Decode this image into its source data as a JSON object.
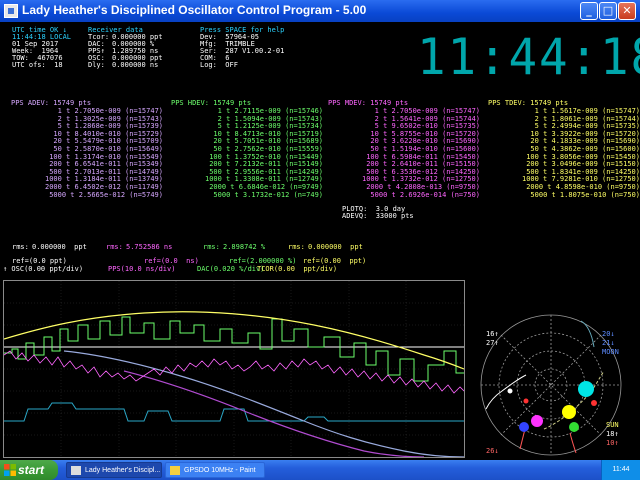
{
  "window": {
    "title": "Lady Heather's Disciplined Oscillator Control Program - 5.00",
    "buttons": {
      "minimize": "_",
      "maximize": "□",
      "close": "✕"
    }
  },
  "status": {
    "col1": [
      "UTC time OK ↓",
      "11:44:18 LOCAL",
      "01 Sep 2017",
      "Week:  1964",
      "TOW:  467076",
      "UTC ofs:  18"
    ],
    "col2": [
      "Receiver data",
      "Tcor:",
      "DAC:",
      "PPS↑",
      "OSC:",
      "Dly:"
    ],
    "col2_values": [
      "",
      "0.000000 ppt",
      "0.000000 %",
      "1.289750 ns",
      "0.000000 ppt",
      "0.000000 ns"
    ],
    "col3": [
      "Press SPACE for help",
      "Dev:  57964-05",
      "Mfg:  TRIMBLE",
      "Ser:  287 V1.00.2-01",
      "COM:  6",
      "Log:  OFF"
    ]
  },
  "clock": "11:44:18",
  "adev": {
    "tables": [
      {
        "header": "PPS ADEV: 15749 pts",
        "color": "#d6a7ff",
        "rows": [
          "1 t 2.7050e-009 (n=15747)",
          "2 t 1.3025e-009 (n=15743)",
          "5 t 1.2868e-009 (n=15739)",
          "10 t 8.4010e-010 (n=15729)",
          "20 t 5.5479e-010 (n=15709)",
          "50 t 2.5870e-010 (n=15649)",
          "100 t 1.3174e-010 (n=15549)",
          "200 t 6.6541e-011 (n=15349)",
          "500 t 2.7013e-011 (n=14749)",
          "1000 t 1.3184e-011 (n=13749)",
          "2000 t 6.4502e-012 (n=11749)",
          "5000 t 2.5665e-012 (n=5749)"
        ]
      },
      {
        "header": "PPS HDEV: 15749 pts",
        "color": "#6cff6c",
        "rows": [
          "1 t 2.7115e-009 (n=15746)",
          "2 t 1.5094e-009 (n=15743)",
          "5 t 1.2125e-009 (n=15734)",
          "10 t 8.4713e-010 (n=15719)",
          "20 t 5.7051e-010 (n=15689)",
          "50 t 2.7562e-010 (n=15559)",
          "100 t 1.3752e-010 (n=15449)",
          "200 t 7.2132e-011 (n=15149)",
          "500 t 2.9556e-011 (n=14249)",
          "1000 t 1.3308e-011 (n=12749)",
          "2000 t 6.6846e-012 (n=9749)",
          "5000 t 3.1732e-012 (n=749)"
        ]
      },
      {
        "header": "PPS MDEV: 15749 pts",
        "color": "#ff66ff",
        "rows": [
          "1 t 2.7050e-009 (n=15747)",
          "2 t 1.5641e-009 (n=15744)",
          "5 t 9.6502e-010 (n=15735)",
          "10 t 5.8755e-010 (n=15720)",
          "20 t 3.6228e-010 (n=15690)",
          "50 t 1.5194e-010 (n=15600)",
          "100 t 6.5984e-011 (n=15450)",
          "200 t 2.6410e-011 (n=15150)",
          "500 t 6.3536e-012 (n=14250)",
          "1000 t 1.3732e-012 (n=12750)",
          "2000 t 4.2808e-013 (n=9750)",
          "5000 t 2.6926e-014 (n=750)"
        ]
      },
      {
        "header": "PPS TDEV: 15749 pts",
        "color": "#ffff66",
        "rows": [
          "1 t 1.5617e-009 (n=15747)",
          "2 t 1.8061e-009 (n=15744)",
          "5 t 2.4994e-009 (n=15735)",
          "10 t 3.3922e-009 (n=15720)",
          "20 t 4.1833e-009 (n=15690)",
          "50 t 4.3862e-009 (n=15600)",
          "100 t 3.8056e-009 (n=15450)",
          "200 t 3.0496e-009 (n=15150)",
          "500 t 1.8341e-009 (n=14250)",
          "1000 t 7.9281e-010 (n=12750)",
          "2000 t 4.8598e-010 (n=9750)",
          "5000 t 1.8075e-010 (n=750)"
        ]
      }
    ]
  },
  "plotq": {
    "line1": "PLOTQ:  3.0 day",
    "line2": "ADEVQ:  33000 pts"
  },
  "rms": {
    "rms1_label": "rms:",
    "rms1_value": "0.000000  ppt",
    "rms2_label": "rms:",
    "rms2_value": "5.752586 ns",
    "rms3_label": "rms:",
    "rms3_value": "2.898742 %",
    "rms4_label": "rms:",
    "rms4_value": "0.000000  ppt"
  },
  "refs": {
    "osc_ref": "ref=(0.0 ppt)",
    "pps_ref": "ref=(0.0  ns)",
    "dac_ref": "ref=(2.000000 %)",
    "tcor_ref": "ref=(0.00  ppt)",
    "osc_scale": "↑ OSC(0.00 ppt/div)",
    "pps_scale": "PPS(10.0 ns/div)",
    "dac_scale": "DAC(0.020 %/div)",
    "tcor_scale": "TCOR(0.00  ppt/div)"
  },
  "satmap": {
    "labels": [
      "16↑",
      "27↑",
      "20↓",
      "21↓",
      "MOON",
      "SUN",
      "18↑",
      "10↑",
      "26↓"
    ]
  },
  "colors": {
    "status_cyan": "#2bd3ff",
    "status_blue": "#5ea8ff",
    "adev": "#d6a7ff",
    "hdev": "#6cff6c",
    "mdev": "#ff66ff",
    "tdev": "#ffff66",
    "osc": "#ffffff",
    "pps": "#ff66ff",
    "dac": "#6cff6c",
    "tcor": "#ffff66"
  },
  "taskbar": {
    "start": "start",
    "tasks": [
      "Lady Heather's Discipl...",
      "GPSDO 10MHz - Paint"
    ],
    "clock": "11:44"
  }
}
